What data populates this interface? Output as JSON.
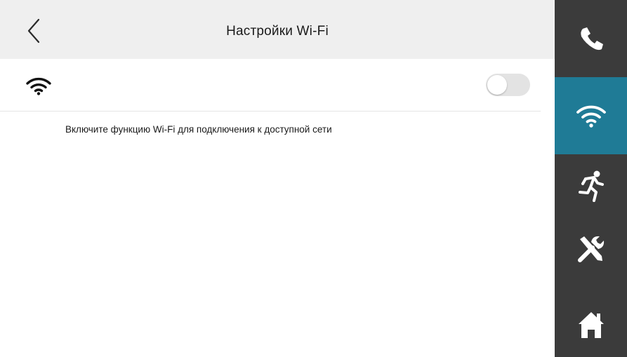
{
  "header": {
    "title": "Настройки Wi-Fi",
    "back_icon": "chevron-left-icon"
  },
  "wifi": {
    "row_icon": "wifi-icon",
    "toggle_enabled": false
  },
  "hint": {
    "text": "Включите функцию Wi-Fi для подключения к доступной сети"
  },
  "sidebar": {
    "items": [
      {
        "icon": "phone-icon",
        "active": false
      },
      {
        "icon": "wifi-icon",
        "active": true
      },
      {
        "icon": "running-person-icon",
        "active": false
      },
      {
        "icon": "tools-icon",
        "active": false
      },
      {
        "icon": "home-icon",
        "active": false
      }
    ]
  },
  "colors": {
    "sidebar_bg": "#3b3b3b",
    "sidebar_active": "#1f7b96",
    "header_bg": "#efefef",
    "toggle_off": "#e3e3e3"
  }
}
